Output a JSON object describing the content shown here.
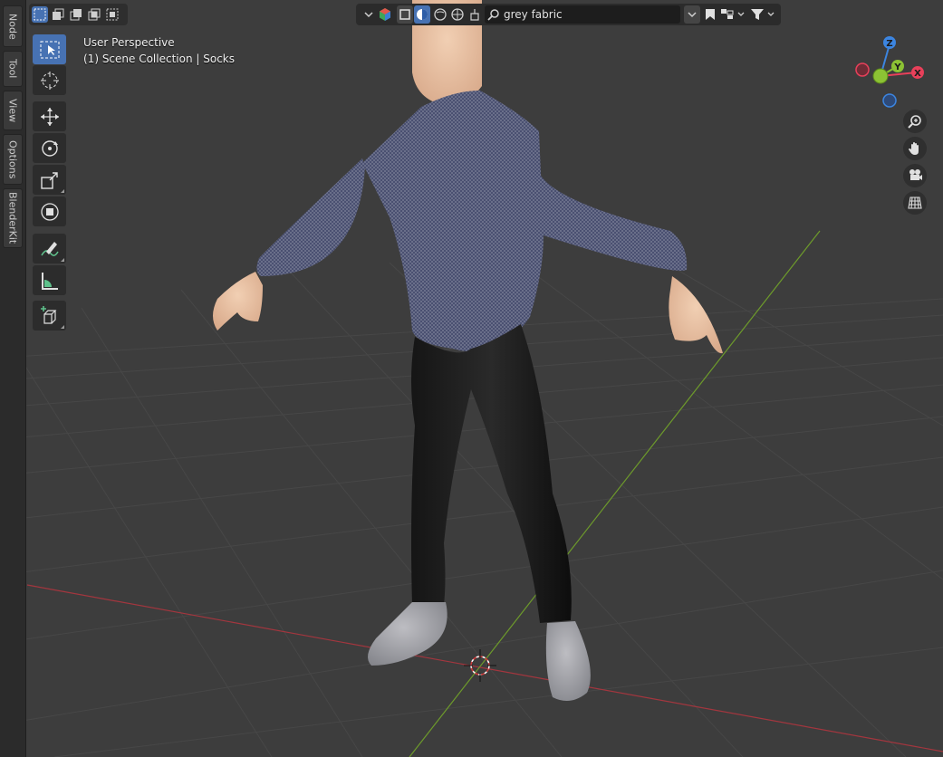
{
  "side_tabs": [
    "Node",
    "Tool",
    "View",
    "Options",
    "BlenderKit"
  ],
  "header": {
    "search_value": "grey fabric",
    "search_placeholder": "Search assets"
  },
  "overlay_info": {
    "view_name": "User Perspective",
    "collection": "(1) Scene Collection | Socks"
  },
  "gizmo": {
    "x_label": "X",
    "y_label": "Y",
    "z_label": "Z",
    "colors": {
      "x": "#e8405a",
      "y": "#8cc234",
      "z": "#3c85e0"
    }
  },
  "icons": {
    "tools": [
      "select-box-icon",
      "cursor-icon",
      "move-icon",
      "rotate-icon",
      "scale-icon",
      "transform-icon",
      "annotate-icon",
      "measure-icon",
      "add-cube-icon"
    ],
    "nav": [
      "zoom-icon",
      "hand-pan-icon",
      "camera-icon",
      "grid-ortho-icon"
    ]
  }
}
